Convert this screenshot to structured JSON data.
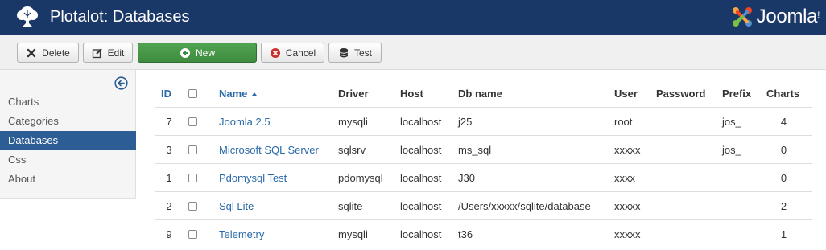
{
  "header": {
    "title": "Plotalot: Databases",
    "brand": "Joomla!",
    "logo_icon": "tree-icon",
    "brand_icon": "joomla-logo-icon",
    "background": "#1a3867"
  },
  "toolbar": {
    "delete_label": "Delete",
    "edit_label": "Edit",
    "new_label": "New",
    "cancel_label": "Cancel",
    "test_label": "Test"
  },
  "sidebar": {
    "items": [
      {
        "label": "Charts"
      },
      {
        "label": "Categories"
      },
      {
        "label": "Databases",
        "active": true
      },
      {
        "label": "Css"
      },
      {
        "label": "About"
      }
    ],
    "active_color": "#2c5d94"
  },
  "table": {
    "columns": {
      "id": "ID",
      "name": "Name",
      "driver": "Driver",
      "host": "Host",
      "db_name": "Db name",
      "user": "User",
      "password": "Password",
      "prefix": "Prefix",
      "charts": "Charts"
    },
    "rows": [
      {
        "id": "7",
        "name": "Joomla 2.5",
        "driver": "mysqli",
        "host": "localhost",
        "db_name": "j25",
        "user": "root",
        "password": "",
        "prefix": "jos_",
        "charts": "4"
      },
      {
        "id": "3",
        "name": "Microsoft SQL Server",
        "driver": "sqlsrv",
        "host": "localhost",
        "db_name": "ms_sql",
        "user": "xxxxx",
        "password": "",
        "prefix": "jos_",
        "charts": "0"
      },
      {
        "id": "1",
        "name": "Pdomysql Test",
        "driver": "pdomysql",
        "host": "localhost",
        "db_name": "J30",
        "user": "xxxx",
        "password": "",
        "prefix": "",
        "charts": "0"
      },
      {
        "id": "2",
        "name": "Sql Lite",
        "driver": "sqlite",
        "host": "localhost",
        "db_name": "/Users/xxxxx/sqlite/database",
        "user": "xxxxx",
        "password": "",
        "prefix": "",
        "charts": "2"
      },
      {
        "id": "9",
        "name": "Telemetry",
        "driver": "mysqli",
        "host": "localhost",
        "db_name": "t36",
        "user": "xxxxx",
        "password": "",
        "prefix": "",
        "charts": "1"
      }
    ],
    "link_color": "#2a6aa8"
  }
}
